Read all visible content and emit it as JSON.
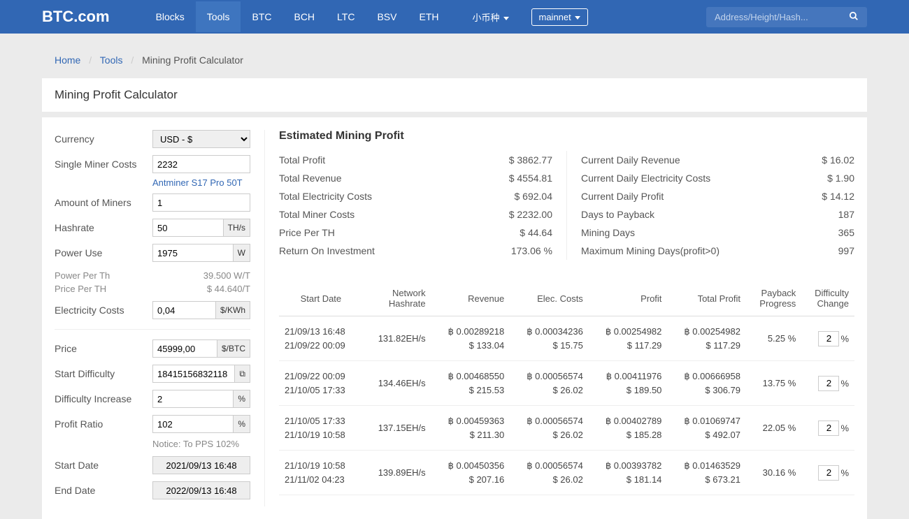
{
  "header": {
    "logo": "BTC.com",
    "nav": [
      "Blocks",
      "Tools",
      "BTC",
      "BCH",
      "LTC",
      "BSV",
      "ETH"
    ],
    "active_nav": 1,
    "small_label": "小币种",
    "network": "mainnet",
    "search_placeholder": "Address/Height/Hash..."
  },
  "breadcrumb": {
    "home": "Home",
    "tools": "Tools",
    "current": "Mining Profit Calculator"
  },
  "page_title": "Mining Profit Calculator",
  "form": {
    "currency_label": "Currency",
    "currency_value": "USD - $",
    "miner_cost_label": "Single Miner Costs",
    "miner_cost_value": "2232",
    "miner_link": "Antminer S17 Pro 50T",
    "amount_label": "Amount of Miners",
    "amount_value": "1",
    "hashrate_label": "Hashrate",
    "hashrate_value": "50",
    "hashrate_unit": "TH/s",
    "power_label": "Power Use",
    "power_value": "1975",
    "power_unit": "W",
    "power_per_th_label": "Power Per Th",
    "power_per_th_value": "39.500 W/T",
    "price_per_th_label": "Price Per TH",
    "price_per_th_value": "$ 44.640/T",
    "elec_label": "Electricity Costs",
    "elec_value": "0,04",
    "elec_unit": "$/KWh",
    "price_label": "Price",
    "price_value": "45999,00",
    "price_unit": "$/BTC",
    "diff_label": "Start Difficulty",
    "diff_value": "18415156832118",
    "diff_icon": "⧉",
    "diff_inc_label": "Difficulty Increase",
    "diff_inc_value": "2",
    "percent_unit": "%",
    "profit_ratio_label": "Profit Ratio",
    "profit_ratio_value": "102",
    "notice": "Notice: To PPS 102%",
    "start_label": "Start Date",
    "start_value": "2021/09/13 16:48",
    "end_label": "End Date",
    "end_value": "2022/09/13 16:48"
  },
  "summary": {
    "title": "Estimated Mining Profit",
    "left": [
      {
        "label": "Total Profit",
        "value": "$ 3862.77"
      },
      {
        "label": "Total Revenue",
        "value": "$ 4554.81"
      },
      {
        "label": "Total Electricity Costs",
        "value": "$ 692.04"
      },
      {
        "label": "Total Miner Costs",
        "value": "$ 2232.00"
      },
      {
        "label": "Price Per TH",
        "value": "$ 44.64"
      },
      {
        "label": "Return On Investment",
        "value": "173.06 %"
      }
    ],
    "right": [
      {
        "label": "Current Daily Revenue",
        "value": "$ 16.02"
      },
      {
        "label": "Current Daily Electricity Costs",
        "value": "$ 1.90"
      },
      {
        "label": "Current Daily Profit",
        "value": "$ 14.12"
      },
      {
        "label": "Days to Payback",
        "value": "187"
      },
      {
        "label": "Mining Days",
        "value": "365"
      },
      {
        "label": "Maximum Mining Days(profit>0)",
        "value": "997"
      }
    ]
  },
  "table": {
    "headers": [
      "Start Date",
      "Network Hashrate",
      "Revenue",
      "Elec. Costs",
      "Profit",
      "Total Profit",
      "Payback Progress",
      "Difficulty Change"
    ],
    "rows": [
      {
        "d1": "21/09/13 16:48",
        "d2": "21/09/22 00:09",
        "hash": "131.82EH/s",
        "rev_b": "฿ 0.00289218",
        "rev_d": "$ 133.04",
        "el_b": "฿ 0.00034236",
        "el_d": "$ 15.75",
        "pr_b": "฿ 0.00254982",
        "pr_d": "$ 117.29",
        "tp_b": "฿ 0.00254982",
        "tp_d": "$ 117.29",
        "pp": "5.25 %",
        "dc": "2"
      },
      {
        "d1": "21/09/22 00:09",
        "d2": "21/10/05 17:33",
        "hash": "134.46EH/s",
        "rev_b": "฿ 0.00468550",
        "rev_d": "$ 215.53",
        "el_b": "฿ 0.00056574",
        "el_d": "$ 26.02",
        "pr_b": "฿ 0.00411976",
        "pr_d": "$ 189.50",
        "tp_b": "฿ 0.00666958",
        "tp_d": "$ 306.79",
        "pp": "13.75 %",
        "dc": "2"
      },
      {
        "d1": "21/10/05 17:33",
        "d2": "21/10/19 10:58",
        "hash": "137.15EH/s",
        "rev_b": "฿ 0.00459363",
        "rev_d": "$ 211.30",
        "el_b": "฿ 0.00056574",
        "el_d": "$ 26.02",
        "pr_b": "฿ 0.00402789",
        "pr_d": "$ 185.28",
        "tp_b": "฿ 0.01069747",
        "tp_d": "$ 492.07",
        "pp": "22.05 %",
        "dc": "2"
      },
      {
        "d1": "21/10/19 10:58",
        "d2": "21/11/02 04:23",
        "hash": "139.89EH/s",
        "rev_b": "฿ 0.00450356",
        "rev_d": "$ 207.16",
        "el_b": "฿ 0.00056574",
        "el_d": "$ 26.02",
        "pr_b": "฿ 0.00393782",
        "pr_d": "$ 181.14",
        "tp_b": "฿ 0.01463529",
        "tp_d": "$ 673.21",
        "pp": "30.16 %",
        "dc": "2"
      }
    ]
  }
}
